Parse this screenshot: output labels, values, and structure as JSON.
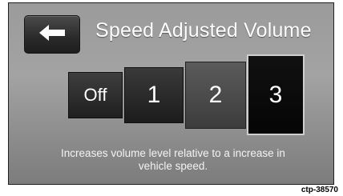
{
  "header": {
    "back_icon": "arrow-left-icon",
    "title": "Speed Adjusted Volume"
  },
  "options": {
    "items": [
      {
        "label": "Off",
        "selected": false
      },
      {
        "label": "1",
        "selected": false
      },
      {
        "label": "2",
        "selected": false
      },
      {
        "label": "3",
        "selected": true
      }
    ]
  },
  "description": "Increases volume level relative to a increase in vehicle speed.",
  "figure_code": "ctp-38570"
}
